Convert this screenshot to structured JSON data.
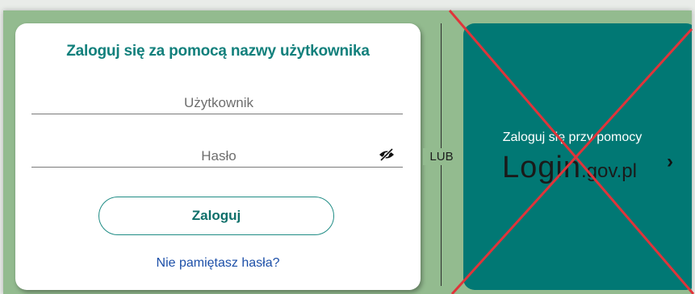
{
  "login_form": {
    "title": "Zaloguj się za pomocą nazwy użytkownika",
    "username_placeholder": "Użytkownik",
    "username_value": "",
    "password_placeholder": "Hasło",
    "password_value": "",
    "toggle_password_icon": "eye-slash-icon",
    "submit_label": "Zaloguj",
    "forgot_link": "Nie pamiętasz hasła?"
  },
  "divider": {
    "label": "LUB"
  },
  "gov_login": {
    "caption": "Zaloguj się przy pomocy",
    "logo_main": "Login",
    "logo_suffix": ".gov.pl",
    "chevron_icon": "chevron-right-icon",
    "crossed_out": true
  },
  "colors": {
    "background": "#93bb8f",
    "title": "#12807c",
    "gov_card": "#017874",
    "cross": "#e0343a",
    "link": "#1c4fa8"
  }
}
